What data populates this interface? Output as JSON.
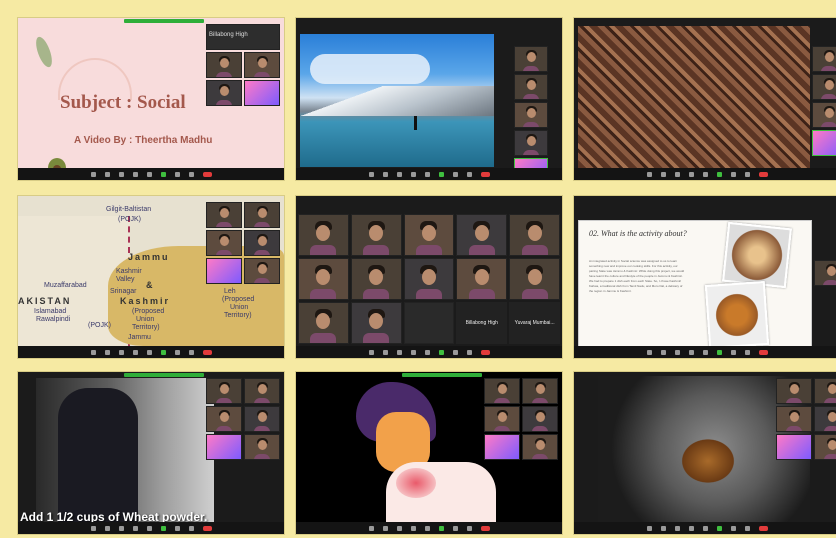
{
  "tile1": {
    "title": "Subject : Social",
    "subtitle": "A Video By : Theertha Madhu",
    "participant_label": "Billabong High"
  },
  "tile4": {
    "labels": {
      "gilgit": "Gilgit-Baltistan",
      "pojk": "(POJK)",
      "jammu1": "Jammu",
      "kashmir_valley": "Kashmir",
      "valley": "Valley",
      "and": "&",
      "srinagar": "Srinagar",
      "kashmir": "Kashmir",
      "proposed_ut": "(Proposed",
      "ut2": "Union",
      "ut3": "Territory)",
      "leh": "Leh",
      "proposed_ut_b": "(Proposed",
      "ut_b2": "Union",
      "ut_b3": "Territory)",
      "muzaffarabad": "Muzaffarabad",
      "pakistan": "AKISTAN",
      "islamabad": "Islamabad",
      "rawalpindi": "Rawalpindi",
      "pojk2": "(POJK)",
      "jammu2": "Jammu"
    }
  },
  "tile5": {
    "names": [
      "Billabong High",
      "Yuvaraj Mumbai..."
    ]
  },
  "tile6": {
    "heading": "02. What is the activity about?",
    "body": "An integrated activity in Social science was assigned to us to learn something new and improve our cooking skills. For this activity, our pairing State was Jammu & Kashmir. While doing this project, we would have learnt the culture and lifestyle of the people in Jammu & Kashmir. We had to prepare 1 dish each from each State. So, I chose Kashmiri Kahwa, a traditional dish from Tamil Nadu, and Moro Dal, a delicacy of the region in Jammu & Kashmir."
  },
  "tile7": {
    "caption": "Add 1 1/2 cups of Wheat powder."
  },
  "colors": {
    "background": "#f6eaa3",
    "title_color": "#a4584c",
    "zoom_green": "#2fae39"
  }
}
